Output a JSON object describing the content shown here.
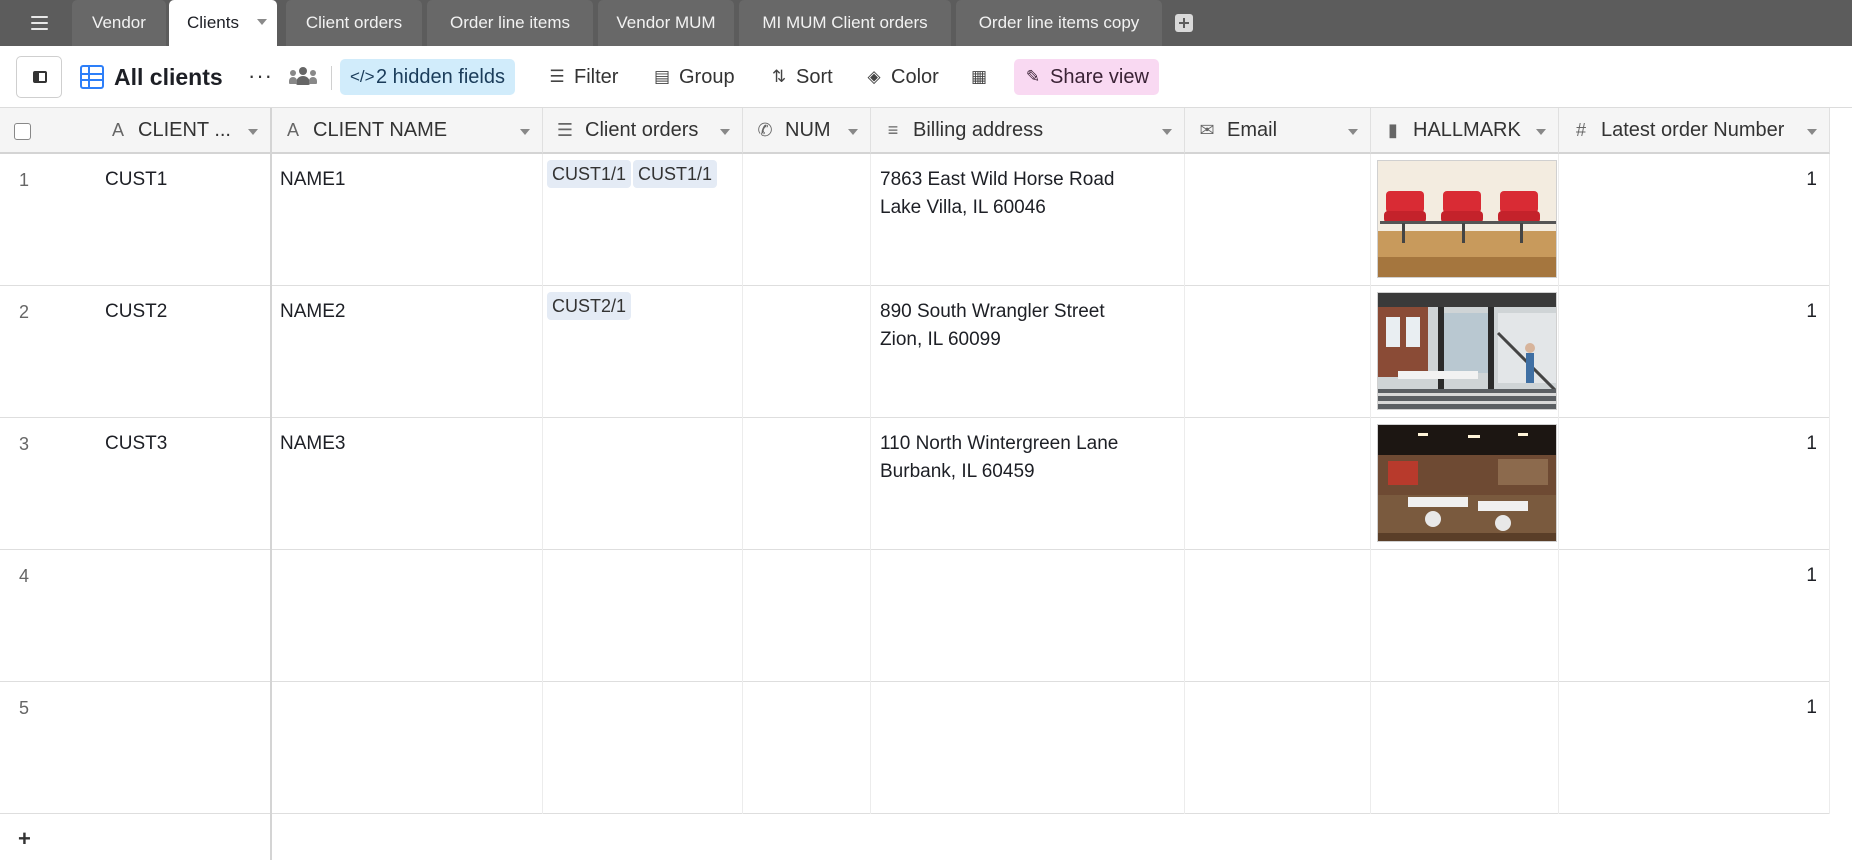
{
  "tabs": [
    {
      "label": "Vendor",
      "active": false
    },
    {
      "label": "Clients",
      "active": true
    },
    {
      "label": "Client orders",
      "active": false
    },
    {
      "label": "Order line items",
      "active": false
    },
    {
      "label": "Vendor MUM",
      "active": false
    },
    {
      "label": "MI MUM Client orders",
      "active": false
    },
    {
      "label": "Order line items copy",
      "active": false
    }
  ],
  "toolbar": {
    "view_name": "All clients",
    "more_label": "···",
    "hidden_fields_label": "2 hidden fields",
    "filter_label": "Filter",
    "group_label": "Group",
    "sort_label": "Sort",
    "color_label": "Color",
    "share_label": "Share view"
  },
  "colors": {
    "accent": "#2d7ff9",
    "hidden_fields_bg": "#d1ecfb",
    "share_bg": "#f9d9f2",
    "chip_bg": "#e4ebf5"
  },
  "columns": [
    {
      "label": "CLIENT ...",
      "icon": "text-field-icon"
    },
    {
      "label": "CLIENT NAME",
      "icon": "text-field-icon"
    },
    {
      "label": "Client orders",
      "icon": "linked-records-icon"
    },
    {
      "label": "NUM",
      "icon": "phone-icon"
    },
    {
      "label": "Billing address",
      "icon": "long-text-icon"
    },
    {
      "label": "Email",
      "icon": "email-icon"
    },
    {
      "label": "HALLMARK",
      "icon": "attachment-icon"
    },
    {
      "label": "Latest order Number",
      "icon": "number-icon"
    }
  ],
  "rows": [
    {
      "num": "1",
      "client_id": "CUST1",
      "client_name": "NAME1",
      "orders": [
        "CUST1/1",
        "CUST1/1"
      ],
      "phone": "",
      "address_line1": "7863 East Wild Horse Road",
      "address_line2": "Lake Villa, IL 60046",
      "email": "",
      "hallmark": "waiting-room-chairs-image",
      "latest_order": "1"
    },
    {
      "num": "2",
      "client_id": "CUST2",
      "client_name": "NAME2",
      "orders": [
        "CUST2/1"
      ],
      "phone": "",
      "address_line1": "890 South Wrangler Street",
      "address_line2": "Zion, IL 60099",
      "email": "",
      "hallmark": "loft-office-image",
      "latest_order": "1"
    },
    {
      "num": "3",
      "client_id": "CUST3",
      "client_name": "NAME3",
      "orders": [],
      "phone": "",
      "address_line1": "110 North Wintergreen Lane",
      "address_line2": "Burbank, IL 60459",
      "email": "",
      "hallmark": "open-office-image",
      "latest_order": "1"
    },
    {
      "num": "4",
      "client_id": "",
      "client_name": "",
      "orders": [],
      "phone": "",
      "address_line1": "",
      "address_line2": "",
      "email": "",
      "hallmark": "",
      "latest_order": "1"
    },
    {
      "num": "5",
      "client_id": "",
      "client_name": "",
      "orders": [],
      "phone": "",
      "address_line1": "",
      "address_line2": "",
      "email": "",
      "hallmark": "",
      "latest_order": "1"
    }
  ],
  "add_row_label": "+"
}
